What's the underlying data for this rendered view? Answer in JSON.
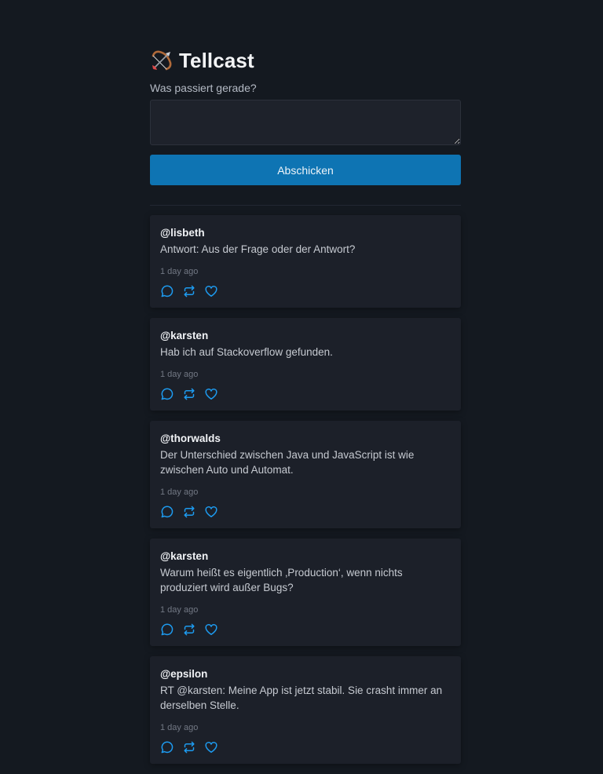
{
  "app": {
    "title": "Tellcast",
    "logo_icon": "bow-and-arrow-icon"
  },
  "composer": {
    "label": "Was passiert gerade?",
    "value": "",
    "placeholder": "",
    "submit_label": "Abschicken"
  },
  "colors": {
    "background": "#141920",
    "card": "#1c2029",
    "accent": "#0e74b3",
    "action_icon": "#1d9bf0"
  },
  "feed": {
    "action_icons": [
      "comment-icon",
      "retweet-icon",
      "heart-icon"
    ],
    "posts": [
      {
        "author": "@lisbeth",
        "content": "Antwort: Aus der Frage oder der Antwort?",
        "time": "1 day ago"
      },
      {
        "author": "@karsten",
        "content": "Hab ich auf Stackoverflow gefunden.",
        "time": "1 day ago"
      },
      {
        "author": "@thorwalds",
        "content": "Der Unterschied zwischen Java und JavaScript ist wie zwischen Auto und Automat.",
        "time": "1 day ago"
      },
      {
        "author": "@karsten",
        "content": "Warum heißt es eigentlich ‚Production‘, wenn nichts produziert wird außer Bugs?",
        "time": "1 day ago"
      },
      {
        "author": "@epsilon",
        "content": "RT @karsten: Meine App ist jetzt stabil. Sie crasht immer an derselben Stelle.",
        "time": "1 day ago"
      }
    ]
  }
}
